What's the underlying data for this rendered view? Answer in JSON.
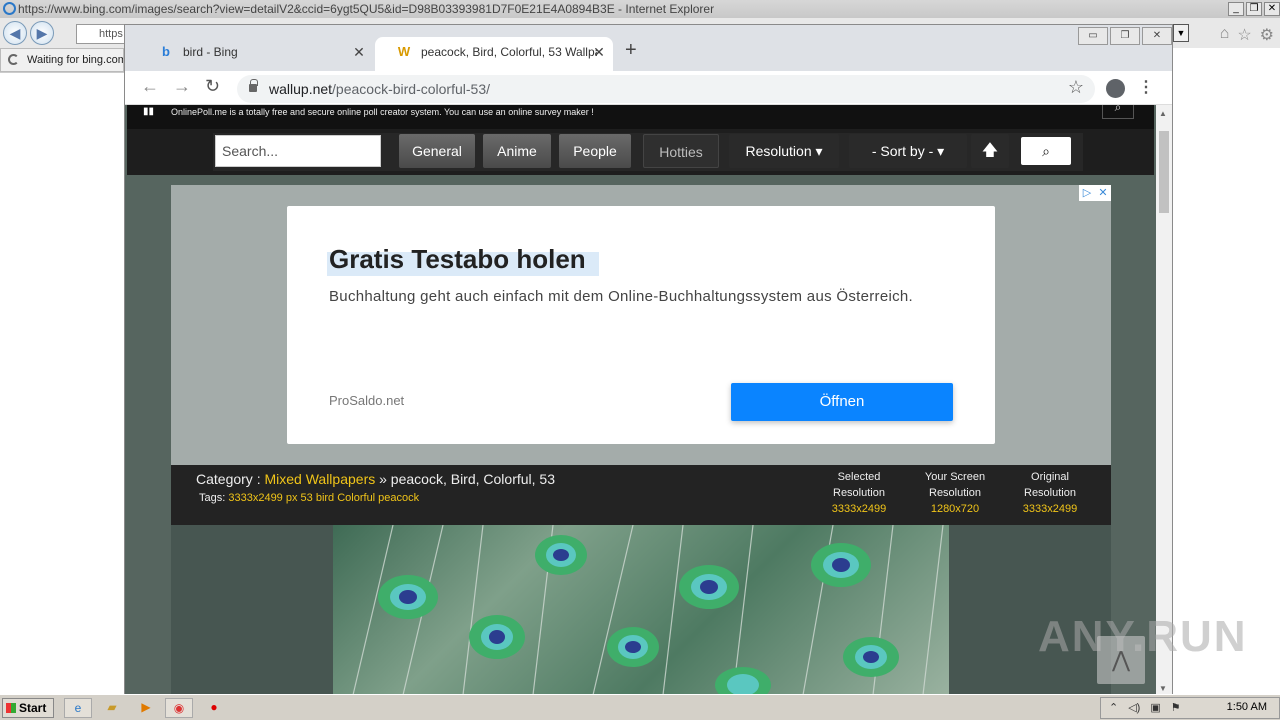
{
  "ie": {
    "title": "https://www.bing.com/images/search?view=detailV2&ccid=6ygt5QU5&id=D98B03393981D7F0E21E4A0894B3E - Internet Explorer",
    "address_fragment": "https",
    "tab_label": "Waiting for bing.com",
    "window_buttons": [
      "_",
      "❐",
      "✕"
    ]
  },
  "chrome": {
    "tabs": [
      {
        "label": "bird - Bing",
        "favicon": "b"
      },
      {
        "label": "peacock, Bird, Colorful, 53 Wallpaper",
        "favicon": "W"
      }
    ],
    "url_host": "wallup.net",
    "url_path": "/peacock-bird-colorful-53/"
  },
  "site": {
    "top_text": "OnlinePoll.me is a totally free and secure online poll creator system. You can use an online survey maker !",
    "search_placeholder": "Search...",
    "nav": {
      "general": "General",
      "anime": "Anime",
      "people": "People",
      "hotties": "Hotties",
      "resolution": "Resolution ▾",
      "sort": "- Sort by - ▾"
    }
  },
  "ad": {
    "title": "Gratis Testabo holen",
    "description": "Buchhaltung geht auch einfach mit dem Online-Buchhaltungssystem aus Österreich.",
    "source": "ProSaldo.net",
    "cta": "Öffnen"
  },
  "category": {
    "prefix": "Category :",
    "link": "Mixed Wallpapers",
    "rest": "» peacock, Bird, Colorful, 53",
    "tags_label": "Tags:",
    "tags": "3333x2499 px 53 bird Colorful peacock",
    "resolutions": [
      {
        "line1": "Selected",
        "line2": "Resolution",
        "value": "3333x2499"
      },
      {
        "line1": "Your Screen",
        "line2": "Resolution",
        "value": "1280x720"
      },
      {
        "line1": "Original",
        "line2": "Resolution",
        "value": "3333x2499"
      }
    ]
  },
  "watermark": "ANY.RUN",
  "taskbar": {
    "start": "Start",
    "time": "1:50 AM"
  },
  "colors": {
    "accent_yellow": "#f0c419",
    "cta_blue": "#0a84ff",
    "page_bg": "#56655f"
  }
}
